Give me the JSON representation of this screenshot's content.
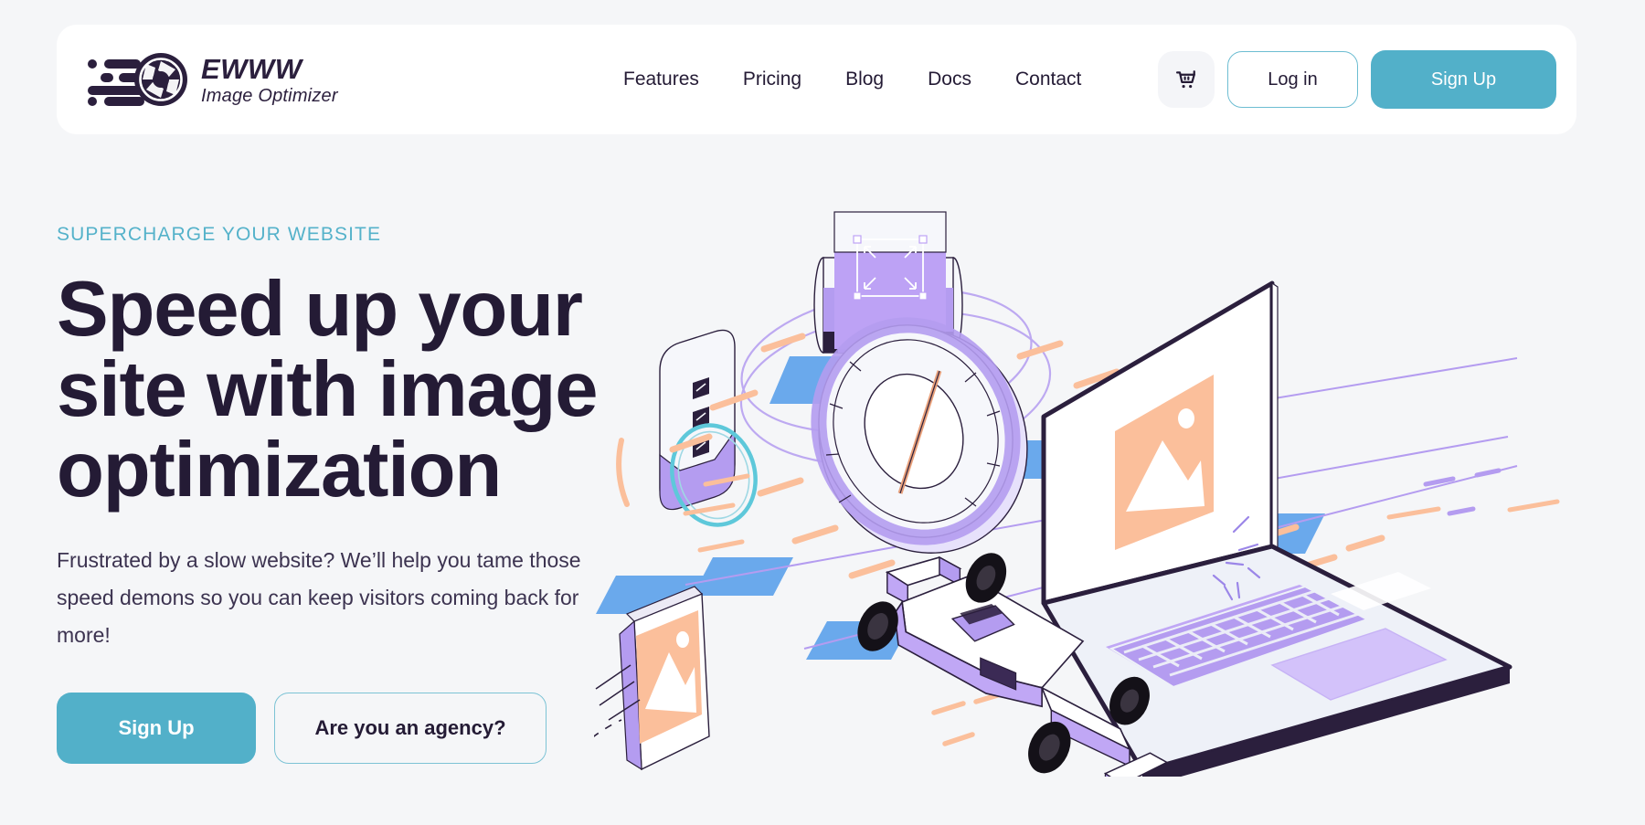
{
  "brand": {
    "name": "EWWW",
    "tagline": "Image Optimizer",
    "logo_icon": "camera-aperture-speed-icon"
  },
  "nav": {
    "items": [
      {
        "label": "Features"
      },
      {
        "label": "Pricing"
      },
      {
        "label": "Blog"
      },
      {
        "label": "Docs"
      },
      {
        "label": "Contact"
      }
    ]
  },
  "header_actions": {
    "cart_icon": "shopping-cart-icon",
    "login_label": "Log in",
    "signup_label": "Sign Up"
  },
  "hero": {
    "eyebrow": "SUPERCHARGE YOUR WEBSITE",
    "title": "Speed up your site with image optimization",
    "description": "Frustrated by a slow website? We’ll help you tame those speed demons so you can keep visitors coming back for more!",
    "primary_cta": "Sign Up",
    "secondary_cta": "Are you an agency?"
  },
  "illustration": {
    "name": "isometric-speed-image-optimization-illustration",
    "elements": [
      "laptop-with-image-placeholder",
      "camera-lens-ring",
      "film-canister-with-crop-handles",
      "rounded-card-with-sliders",
      "framed-photo-with-motion-trail",
      "formula-one-race-car",
      "orbit-rings",
      "speed-dashes"
    ]
  },
  "colors": {
    "page_background": "#f5f6f8",
    "card_background": "#ffffff",
    "accent_teal": "#52b0c9",
    "accent_teal_border": "#7cc3d5",
    "text_dark": "#241b35",
    "text_body": "#3c3350",
    "illustration_purple": "#b49cf0",
    "illustration_purple_light": "#d9c9f9",
    "illustration_peach": "#fbbf9b",
    "illustration_blue": "#6aa9ec",
    "illustration_outline": "#2b1f3d"
  }
}
